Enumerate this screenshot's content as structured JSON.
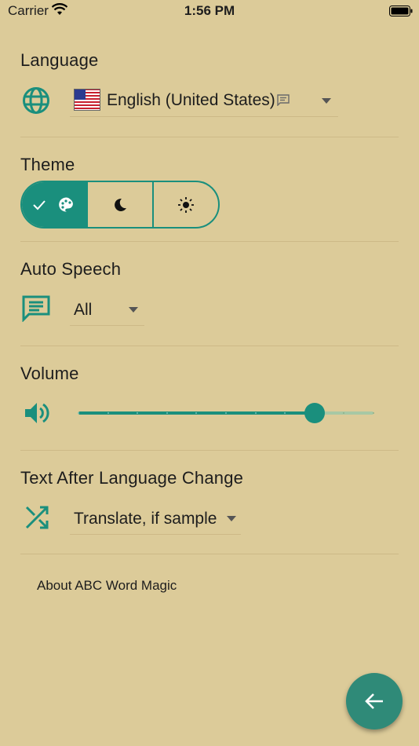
{
  "status_bar": {
    "carrier": "Carrier",
    "time": "1:56 PM"
  },
  "language": {
    "title": "Language",
    "value": "English (United States)"
  },
  "theme": {
    "title": "Theme",
    "options": [
      "palette",
      "dark",
      "light"
    ],
    "selected": "palette"
  },
  "auto_speech": {
    "title": "Auto Speech",
    "value": "All"
  },
  "volume": {
    "title": "Volume",
    "level": 0.8,
    "steps": 10
  },
  "text_after_language_change": {
    "title": "Text After Language Change",
    "value": "Translate, if sample"
  },
  "about": {
    "label": "About ABC Word Magic"
  },
  "colors": {
    "background": "#dccb99",
    "accent": "#1a8f7d",
    "fab": "#2f8a78"
  },
  "icons": [
    "wifi-icon",
    "battery-icon",
    "globe-icon",
    "us-flag-icon",
    "message-text-icon",
    "check-icon",
    "palette-icon",
    "moon-icon",
    "sun-icon",
    "speech-list-icon",
    "volume-icon",
    "shuffle-icon",
    "arrow-left-icon"
  ]
}
